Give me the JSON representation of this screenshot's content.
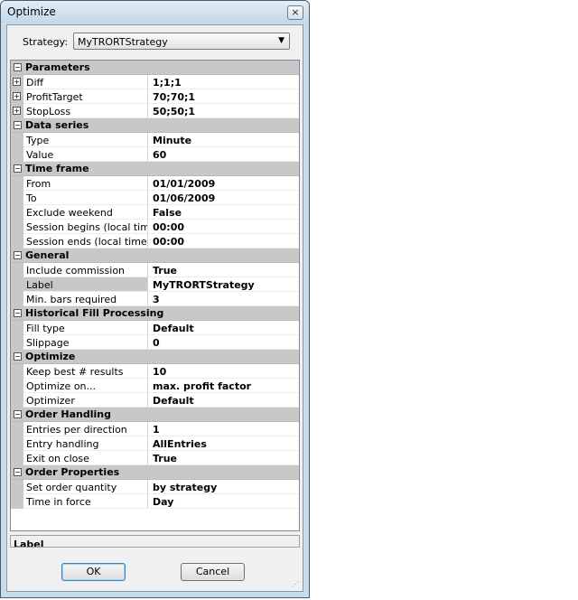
{
  "window": {
    "title": "Optimize",
    "close_symbol": "×"
  },
  "strategy": {
    "label": "Strategy:",
    "value": "MyTRORTStrategy"
  },
  "grid": {
    "categories": [
      {
        "name": "Parameters",
        "props": [
          {
            "name": "Diff",
            "value": "1;1;1",
            "expandable": true
          },
          {
            "name": "ProfitTarget",
            "value": "70;70;1",
            "expandable": true
          },
          {
            "name": "StopLoss",
            "value": "50;50;1",
            "expandable": true
          }
        ]
      },
      {
        "name": "Data series",
        "props": [
          {
            "name": "Type",
            "value": "Minute"
          },
          {
            "name": "Value",
            "value": "60"
          }
        ]
      },
      {
        "name": "Time frame",
        "props": [
          {
            "name": "From",
            "value": "01/01/2009"
          },
          {
            "name": "To",
            "value": "01/06/2009"
          },
          {
            "name": "Exclude weekend",
            "value": "False"
          },
          {
            "name": "Session begins (local time)",
            "value": "00:00"
          },
          {
            "name": "Session ends (local time)",
            "value": "00:00"
          }
        ]
      },
      {
        "name": "General",
        "props": [
          {
            "name": "Include commission",
            "value": "True"
          },
          {
            "name": "Label",
            "value": "MyTRORTStrategy",
            "selected": true
          },
          {
            "name": "Min. bars required",
            "value": "3"
          }
        ]
      },
      {
        "name": "Historical Fill Processing",
        "props": [
          {
            "name": "Fill type",
            "value": "Default"
          },
          {
            "name": "Slippage",
            "value": "0"
          }
        ]
      },
      {
        "name": "Optimize",
        "props": [
          {
            "name": "Keep best # results",
            "value": "10"
          },
          {
            "name": "Optimize on...",
            "value": "max. profit factor"
          },
          {
            "name": "Optimizer",
            "value": "Default"
          }
        ]
      },
      {
        "name": "Order Handling",
        "props": [
          {
            "name": "Entries per direction",
            "value": "1"
          },
          {
            "name": "Entry handling",
            "value": "AllEntries"
          },
          {
            "name": "Exit on close",
            "value": "True"
          }
        ]
      },
      {
        "name": "Order Properties",
        "props": [
          {
            "name": "Set order quantity",
            "value": "by strategy"
          },
          {
            "name": "Time in force",
            "value": "Day"
          }
        ]
      }
    ]
  },
  "description": {
    "title": "Label"
  },
  "buttons": {
    "ok": "OK",
    "cancel": "Cancel"
  }
}
